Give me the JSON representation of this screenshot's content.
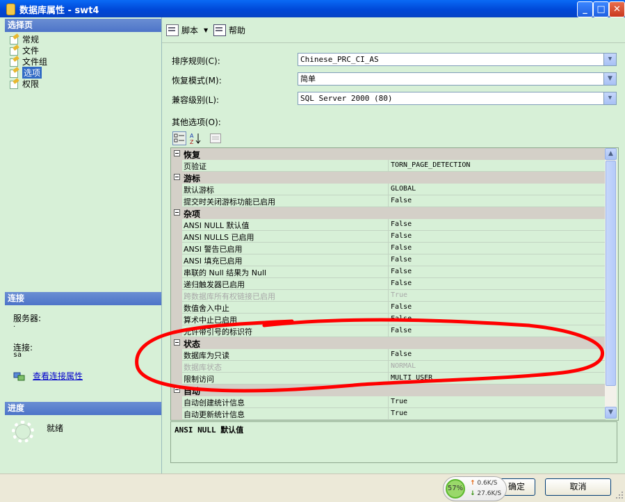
{
  "window": {
    "title": "数据库属性 - swt4",
    "controls": [
      "minimize",
      "maximize",
      "close"
    ]
  },
  "left_pane": {
    "select_page_header": "选择页",
    "pages": [
      {
        "label": "常规",
        "icon": "page-settings-icon",
        "selected": false
      },
      {
        "label": "文件",
        "icon": "page-settings-icon",
        "selected": false
      },
      {
        "label": "文件组",
        "icon": "page-settings-icon",
        "selected": false
      },
      {
        "label": "选项",
        "icon": "page-settings-icon",
        "selected": true
      },
      {
        "label": "权限",
        "icon": "page-settings-icon",
        "selected": false
      }
    ],
    "connection_header": "连接",
    "server_label": "服务器:",
    "server_value": ".",
    "connection_label": "连接:",
    "connection_value": "sa",
    "view_connection_link": "查看连接属性",
    "progress_header": "进度",
    "progress_status": "就绪"
  },
  "toolbar": {
    "script_label": "脚本",
    "help_label": "帮助"
  },
  "fields": {
    "collation_label": "排序规则(C):",
    "collation_value": "Chinese_PRC_CI_AS",
    "recovery_label": "恢复模式(M):",
    "recovery_value": "简单",
    "compat_label": "兼容级别(L):",
    "compat_value": "SQL Server 2000 (80)",
    "other_options_label": "其他选项(O):"
  },
  "property_grid": {
    "rows": [
      {
        "type": "category",
        "name": "恢复"
      },
      {
        "type": "prop",
        "name": "页验证",
        "value": "TORN_PAGE_DETECTION",
        "disabled": false
      },
      {
        "type": "category",
        "name": "游标"
      },
      {
        "type": "prop",
        "name": "默认游标",
        "value": "GLOBAL",
        "disabled": false
      },
      {
        "type": "prop",
        "name": "提交时关闭游标功能已启用",
        "value": "False",
        "disabled": false
      },
      {
        "type": "category",
        "name": "杂项"
      },
      {
        "type": "prop",
        "name": "ANSI NULL 默认值",
        "value": "False",
        "disabled": false
      },
      {
        "type": "prop",
        "name": "ANSI NULLS 已启用",
        "value": "False",
        "disabled": false
      },
      {
        "type": "prop",
        "name": "ANSI 警告已启用",
        "value": "False",
        "disabled": false
      },
      {
        "type": "prop",
        "name": "ANSI 填充已启用",
        "value": "False",
        "disabled": false
      },
      {
        "type": "prop",
        "name": "串联的 Null 结果为 Null",
        "value": "False",
        "disabled": false
      },
      {
        "type": "prop",
        "name": "递归触发器已启用",
        "value": "False",
        "disabled": false
      },
      {
        "type": "prop",
        "name": "跨数据库所有权链接已启用",
        "value": "True",
        "disabled": true
      },
      {
        "type": "prop",
        "name": "数值舍入中止",
        "value": "False",
        "disabled": false
      },
      {
        "type": "prop",
        "name": "算术中止已启用",
        "value": "False",
        "disabled": false
      },
      {
        "type": "prop",
        "name": "允许带引号的标识符",
        "value": "False",
        "disabled": false
      },
      {
        "type": "category",
        "name": "状态"
      },
      {
        "type": "prop",
        "name": "数据库为只读",
        "value": "False",
        "disabled": false
      },
      {
        "type": "prop",
        "name": "数据库状态",
        "value": "NORMAL",
        "disabled": true
      },
      {
        "type": "prop",
        "name": "限制访问",
        "value": "MULTI_USER",
        "disabled": false
      },
      {
        "type": "category",
        "name": "自动"
      },
      {
        "type": "prop",
        "name": "自动创建统计信息",
        "value": "True",
        "disabled": false
      },
      {
        "type": "prop",
        "name": "自动更新统计信息",
        "value": "True",
        "disabled": false
      }
    ],
    "description_title": "ANSI NULL 默认值"
  },
  "buttons": {
    "ok_label": "确定",
    "cancel_label": "取消"
  },
  "net_meter": {
    "percent": "57%",
    "upload": "0.6K/S",
    "download": "27.6K/S"
  },
  "colors": {
    "pane_bg": "#d7f0d7",
    "annotation": "#ff0000",
    "titlebar": "#0a5de8"
  }
}
